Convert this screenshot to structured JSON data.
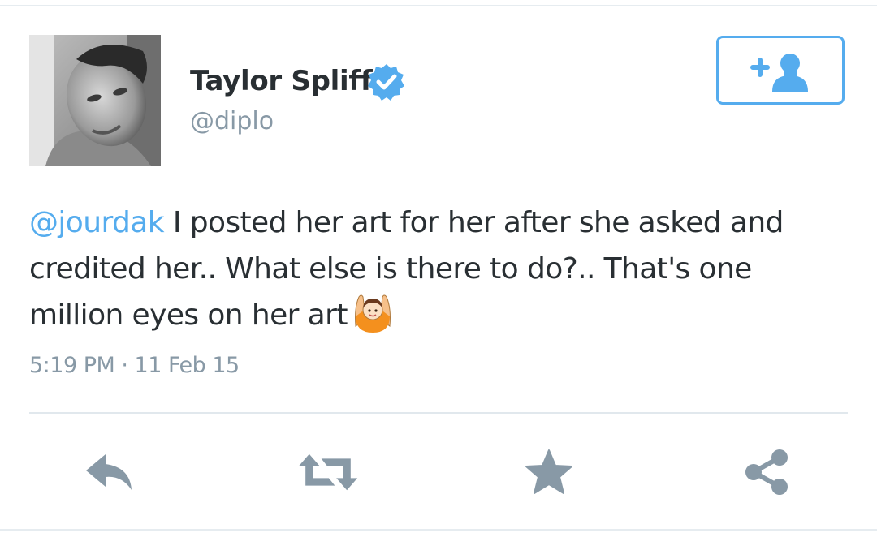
{
  "tweet": {
    "author": {
      "display_name": "Taylor Spliff",
      "handle": "@diplo",
      "verified": true
    },
    "text_lines": [
      {
        "mention": "@jourdak",
        "rest": " I posted her art for her after she asked and"
      },
      {
        "text": "credited her.. What else is there to do?.. That's one"
      },
      {
        "text": "million eyes on her art"
      }
    ],
    "timestamp": "5:19 PM · 11 Feb 15"
  },
  "icons": {
    "follow": "add-user-icon",
    "verified": "verified-badge-icon",
    "emoji": "person-raising-hands-emoji",
    "reply": "reply-icon",
    "retweet": "retweet-icon",
    "favorite": "star-icon",
    "share": "share-icon"
  },
  "colors": {
    "accent": "#55acee",
    "text": "#292f33",
    "secondary_text": "#8899a6",
    "action_icon": "#8899a6",
    "divider": "#e1e8ed"
  }
}
